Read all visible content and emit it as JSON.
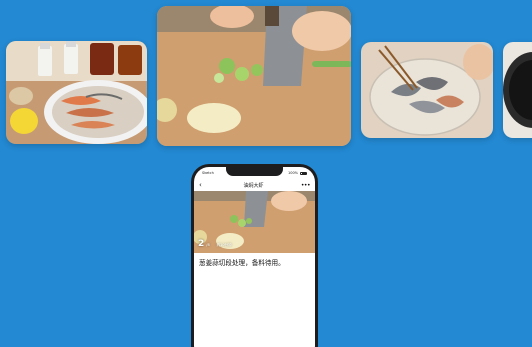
{
  "page": {
    "background_color": "#2389d2"
  },
  "carousel": {
    "cards": [
      {
        "subject": "shrimp-ingredients-photo"
      },
      {
        "subject": "chopping-scallions-photo"
      },
      {
        "subject": "shrimp-glass-bowl-photo"
      },
      {
        "subject": "wok-photo"
      }
    ]
  },
  "phone": {
    "status_bar": {
      "carrier": "Sketch",
      "time": "9:41 AM",
      "battery": "100%"
    },
    "nav": {
      "back_icon": "‹",
      "title": "油焖大虾",
      "more_icon": "•••"
    },
    "step": {
      "number": "2",
      "total": "/8",
      "duration": "约10分钟",
      "description": "葱姜蒜切段处理，备料待用。"
    }
  }
}
